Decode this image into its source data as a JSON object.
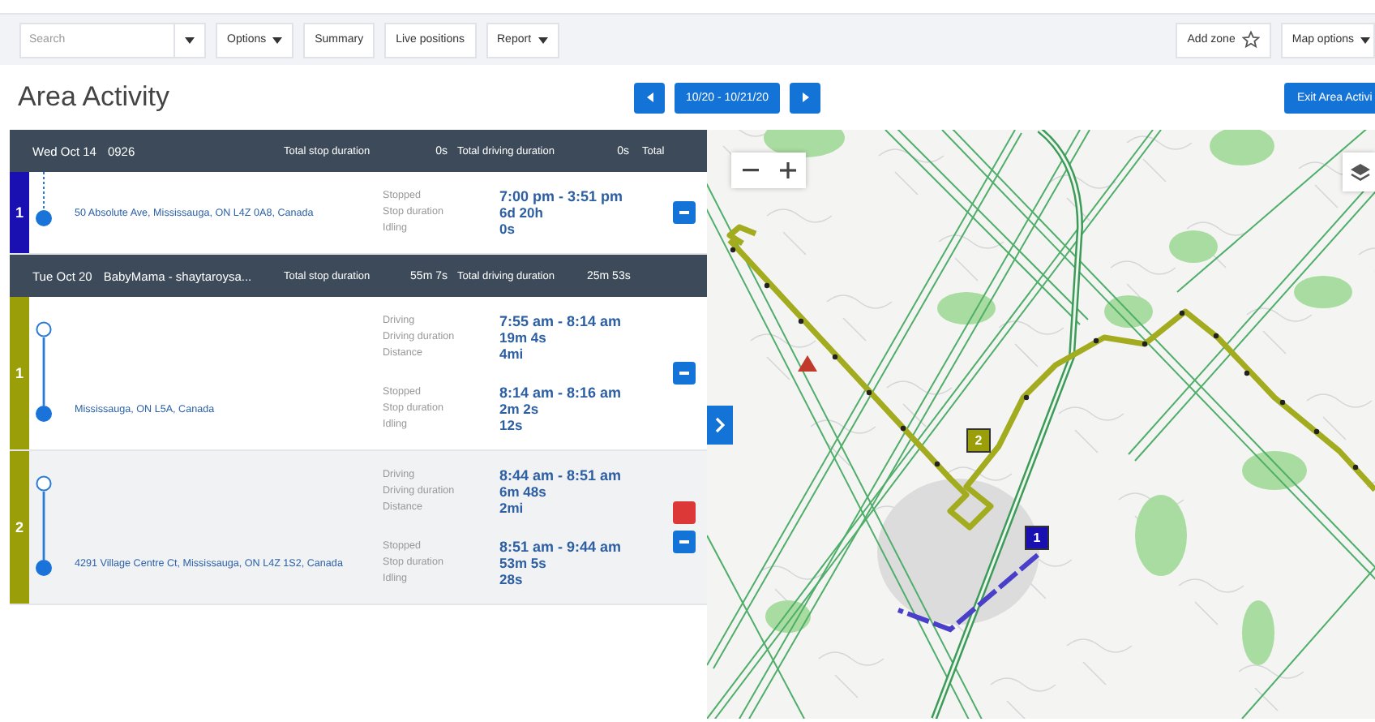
{
  "toolbar": {
    "search": {
      "placeholder": "Search"
    },
    "left_buttons": [
      {
        "label": "Options",
        "dropdown": true
      },
      {
        "label": "Summary",
        "dropdown": false
      },
      {
        "label": "Live positions",
        "dropdown": false
      },
      {
        "label": "Report",
        "dropdown": true
      }
    ],
    "add_zone": "Add zone",
    "map_options": "Map options"
  },
  "title": "Area Activity",
  "date_range": "10/20 - 10/21/20",
  "exit_button": "Exit Area Activi",
  "groups": [
    {
      "date": "Wed Oct 14",
      "vehicle": "0926",
      "stop_label": "Total stop duration",
      "stop_value": "0s",
      "drive_label": "Total driving duration",
      "drive_value": "0s",
      "extra": "Total",
      "rows": [
        {
          "number": "1",
          "color": "#1a0fb0",
          "kind": "stop",
          "selected": false,
          "address": "50 Absolute Ave, Mississauga, ON L4Z 0A8, Canada",
          "alert": false,
          "segments": [
            {
              "lines": [
                {
                  "label": "Stopped",
                  "value": "7:00 pm - 3:51 pm"
                },
                {
                  "label": "Stop duration",
                  "value": "6d 20h"
                },
                {
                  "label": "Idling",
                  "value": "0s"
                }
              ]
            }
          ]
        }
      ]
    },
    {
      "date": "Tue Oct 20",
      "vehicle": "BabyMama - shaytaroysa...",
      "stop_label": "Total stop duration",
      "stop_value": "55m 7s",
      "drive_label": "Total driving duration",
      "drive_value": "25m 53s",
      "rows": [
        {
          "number": "1",
          "color": "#9a9e08",
          "kind": "trip",
          "selected": false,
          "address": "Mississauga, ON L5A, Canada",
          "alert": false,
          "segments": [
            {
              "lines": [
                {
                  "label": "Driving",
                  "value": "7:55 am - 8:14 am"
                },
                {
                  "label": "Driving duration",
                  "value": "19m 4s"
                },
                {
                  "label": "Distance",
                  "value": "4mi"
                }
              ]
            },
            {
              "lines": [
                {
                  "label": "Stopped",
                  "value": "8:14 am - 8:16 am"
                },
                {
                  "label": "Stop duration",
                  "value": "2m 2s"
                },
                {
                  "label": "Idling",
                  "value": "12s"
                }
              ]
            }
          ]
        },
        {
          "number": "2",
          "color": "#9a9e08",
          "kind": "trip",
          "selected": true,
          "address": "4291 Village Centre Ct, Mississauga, ON L4Z 1S2, Canada",
          "alert": true,
          "segments": [
            {
              "lines": [
                {
                  "label": "Driving",
                  "value": "8:44 am - 8:51 am"
                },
                {
                  "label": "Driving duration",
                  "value": "6m 48s"
                },
                {
                  "label": "Distance",
                  "value": "2mi"
                }
              ]
            },
            {
              "lines": [
                {
                  "label": "Stopped",
                  "value": "8:51 am - 9:44 am"
                },
                {
                  "label": "Stop duration",
                  "value": "53m 5s"
                },
                {
                  "label": "Idling",
                  "value": "28s"
                }
              ]
            }
          ]
        }
      ]
    }
  ],
  "map": {
    "markers": [
      {
        "number": "2",
        "color": "#9a9e08"
      },
      {
        "number": "1",
        "color": "#1a0fb0"
      }
    ]
  }
}
